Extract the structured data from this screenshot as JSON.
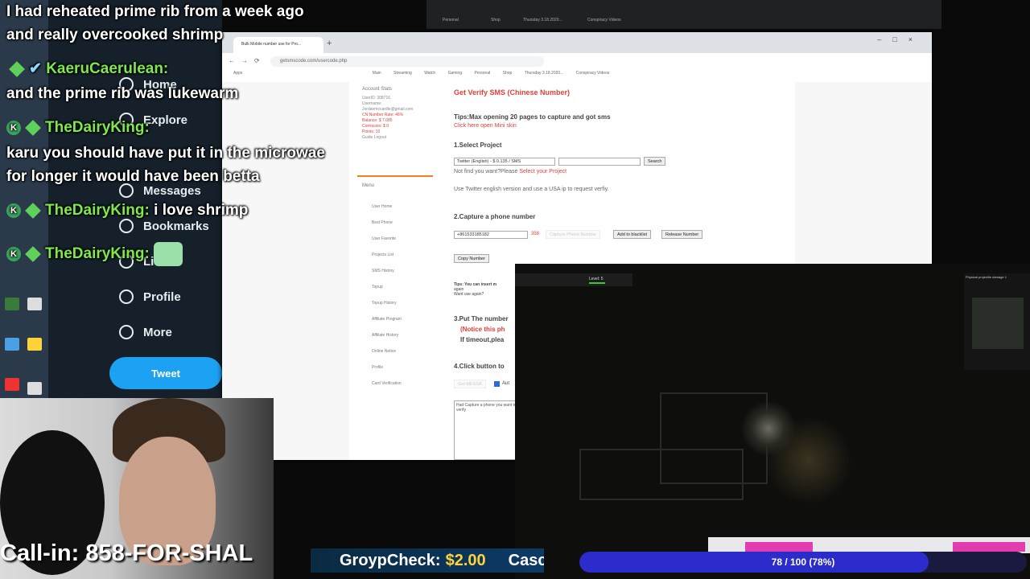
{
  "chat": [
    {
      "user": "",
      "text": "I had reheated prime rib from a week ago"
    },
    {
      "user": "",
      "text": "and really overcooked shrimp"
    },
    {
      "user": "KaeruCaerulean:",
      "text": ""
    },
    {
      "user": "",
      "text": "and the prime rib was lukewarm"
    },
    {
      "user": "TheDairyKing:",
      "text": ""
    },
    {
      "user": "",
      "text": "karu you should have put it in the microwae"
    },
    {
      "user": "",
      "text": "for longer it would have been betta"
    },
    {
      "user": "TheDairyKing:",
      "text": "i love shrimp"
    },
    {
      "user": "TheDairyKing:",
      "text": ""
    }
  ],
  "twitter": {
    "nav": [
      "Home",
      "Explore",
      "Messages",
      "Bookmarks",
      "Lists",
      "Profile",
      "More"
    ],
    "tweet_button": "Tweet"
  },
  "browser": {
    "tab_title": "Bulk Mobile number use for Pro...",
    "url": "getsmscode.com/usercode.php",
    "bookmarks": [
      "Apps",
      "Main",
      "Streaming",
      "Watch",
      "Gaming",
      "Personal",
      "Shop",
      "Thursday 3.18.2020...",
      "Conspiracy Videos"
    ]
  },
  "site": {
    "account": {
      "heading": "Account Stats",
      "lines": [
        "UserID: 308716",
        "Username:",
        "Jordanmccardle@gmail.com",
        "CN Number Rate: 46%",
        "Balance: $ 7.085",
        "Comission: $ 0",
        "Points: 10",
        "Guide  Logout"
      ]
    },
    "menu_title": "Menu",
    "menu": [
      "User Home",
      "Best Phone",
      "User Favorite",
      "Projects List",
      "SMS History",
      "Topup",
      "Topup History",
      "Affiliate Program",
      "Affiliate History",
      "Online Notice",
      "Profile",
      "Card Verification"
    ],
    "title": "Get Verify SMS (Chinese Number)",
    "tips": "Tips:Max opening 20 pages to capture and got sms",
    "mini_skin": "Click here open Mini skin",
    "step1": "1.Select Project",
    "project_value": "Twitter (English) - $ 0.135 / SMS",
    "search": "Search",
    "not_find": "Not find you want?Please",
    "select_project": "Select your Project",
    "twitter_note": "Use Twitter english version and use a USA ip to request verfiy.",
    "step2": "2.Capture a phone number",
    "phone": "+861533185182",
    "countdown": "358",
    "capture_btn": "Capture Phone Number",
    "blacklist_btn": "Add to blacklist",
    "release_btn": "Release Number",
    "copy_btn": "Copy Number",
    "tips2": "Tips: You can insert m",
    "again": "again",
    "use_again": "Want use again?",
    "step3": "3.Put The number",
    "notice": "(Notice this ph",
    "timeout": "If timeout,plea",
    "step4": "4.Click button to",
    "get_msg": "Get MESSA",
    "auto": "Aut",
    "textarea": "Had Capture a phone  you want to verify"
  },
  "game": {
    "level": "Level: 5",
    "minimap_title": "Physical projectile damage 1"
  },
  "stream": {
    "callin": "Call-in: 858-FOR-SHAL",
    "donor": "GroypCheck:",
    "amount": "$2.00",
    "next": "Casca",
    "progress_text": "78 / 100 (78%)",
    "progress_value": 0.78
  }
}
